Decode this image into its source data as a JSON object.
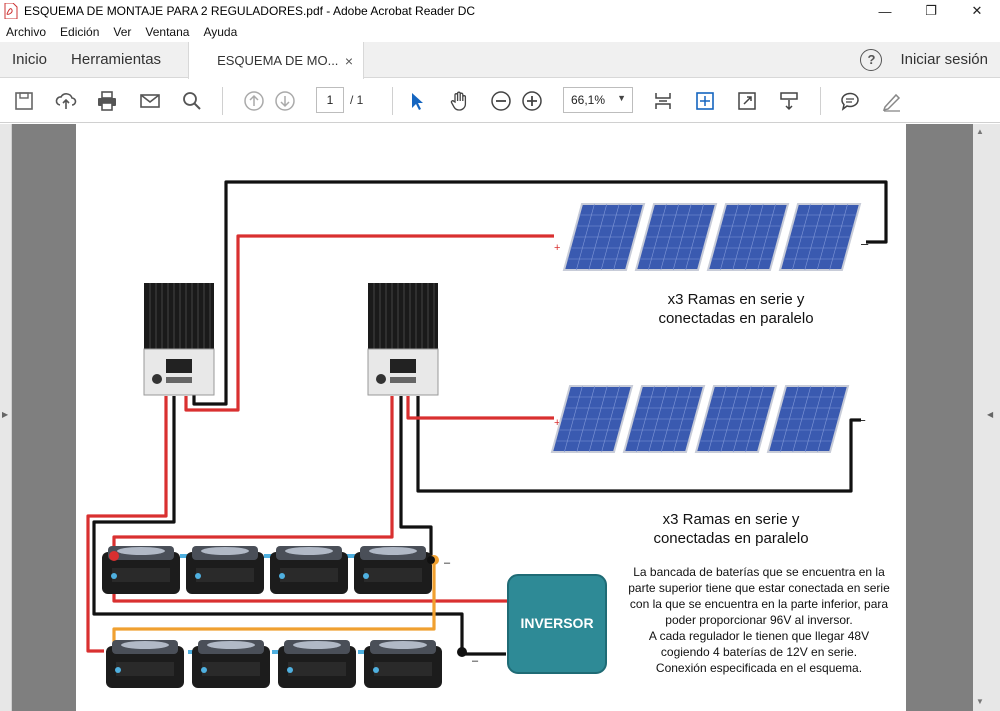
{
  "window": {
    "title": "ESQUEMA DE MONTAJE PARA 2 REGULADORES.pdf - Adobe Acrobat Reader DC",
    "minimize": "—",
    "restore": "❐",
    "close": "✕"
  },
  "menu": [
    "Archivo",
    "Edición",
    "Ver",
    "Ventana",
    "Ayuda"
  ],
  "tabs": {
    "home": "Inicio",
    "tools": "Herramientas",
    "document": "ESQUEMA DE MO...",
    "document_close": "×",
    "help": "?",
    "signin": "Iniciar sesión"
  },
  "toolbar": {
    "page_current": "1",
    "page_total": "/ 1",
    "zoom": "66,1%",
    "zoom_arrow": "▼",
    "icons": [
      "save-icon",
      "upload-icon",
      "print-icon",
      "email-icon",
      "search-icon",
      "prev-page-icon",
      "next-page-icon",
      "select-arrow-icon",
      "hand-icon",
      "zoom-out-icon",
      "zoom-in-icon",
      "fit-page-icon",
      "full-screen-icon",
      "read-mode-icon",
      "scroll-mode-icon",
      "comment-icon",
      "sign-icon"
    ]
  },
  "viewer": {
    "left_arrow": "◀",
    "right_arrow": "◀",
    "scroll_up": "▲",
    "scroll_down": "▼"
  },
  "diagram": {
    "label_top_1": "x3 Ramas en serie y",
    "label_top_2": "conectadas en paralelo",
    "label_mid_1": "x3 Ramas en serie y",
    "label_mid_2": "conectadas en paralelo",
    "inverter": "INVERSOR",
    "plus": "+",
    "minus": "–",
    "note": [
      "La bancada de baterías que se encuentra en la",
      "parte superior tiene que estar conectada en serie",
      "con la que se encuentra en la parte inferior, para",
      "poder proporcionar 96V al inversor.",
      "A cada regulador le tienen que llegar 48V",
      "cogiendo 4 baterías de 12V en serie.",
      "Conexión especificada en el esquema."
    ],
    "colors": {
      "positive": "#d93030",
      "negative": "#111111",
      "series_link": "#f0a030",
      "battery_link": "#4fb0e0",
      "inverter": "#2e8a96",
      "panel": "#3a5ab0"
    }
  }
}
